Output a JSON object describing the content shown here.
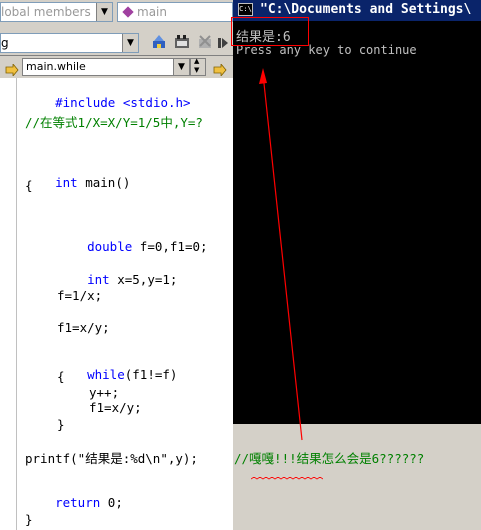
{
  "toolbar": {
    "globals_combo": "lobal members",
    "function_combo": "main",
    "config_combo": "g"
  },
  "nav": {
    "wizard_combo": "main.while"
  },
  "console": {
    "title": "\"C:\\Documents and Settings\\",
    "title_icon_text": "C:\\",
    "result_line": "结果是:6",
    "press_line": "Press any key to continue"
  },
  "code": {
    "include": "#include <stdio.h>",
    "comment1": "//在等式1/X=X/Y=1/5中,Y=?",
    "int_kw": "int",
    "main_sig": " main()",
    "open_brace": "{",
    "double_kw": "double",
    "double_rest": " f=0,f1=0;",
    "int2_kw": "int",
    "int2_rest": " x=5,y=1;",
    "f_assign": "f=1/x;",
    "f1_assign": "f1=x/y;",
    "while_kw": "while",
    "while_rest": "(f1!=f)",
    "inner_open": "{",
    "yinc": "y++;",
    "f1_assign2": "f1=x/y;",
    "inner_close": "}",
    "printf_line": "printf(\"结果是:%d\\n\",y);",
    "annotation": "//嘎嘎!!!结果怎么会是6??????",
    "return_kw": "return",
    "return_rest": " 0;",
    "close_brace": "}"
  },
  "colors": {
    "keyword": "#0000ff",
    "comment": "#008000",
    "highlight_box": "#ff0000",
    "arrow": "#ff0000"
  }
}
